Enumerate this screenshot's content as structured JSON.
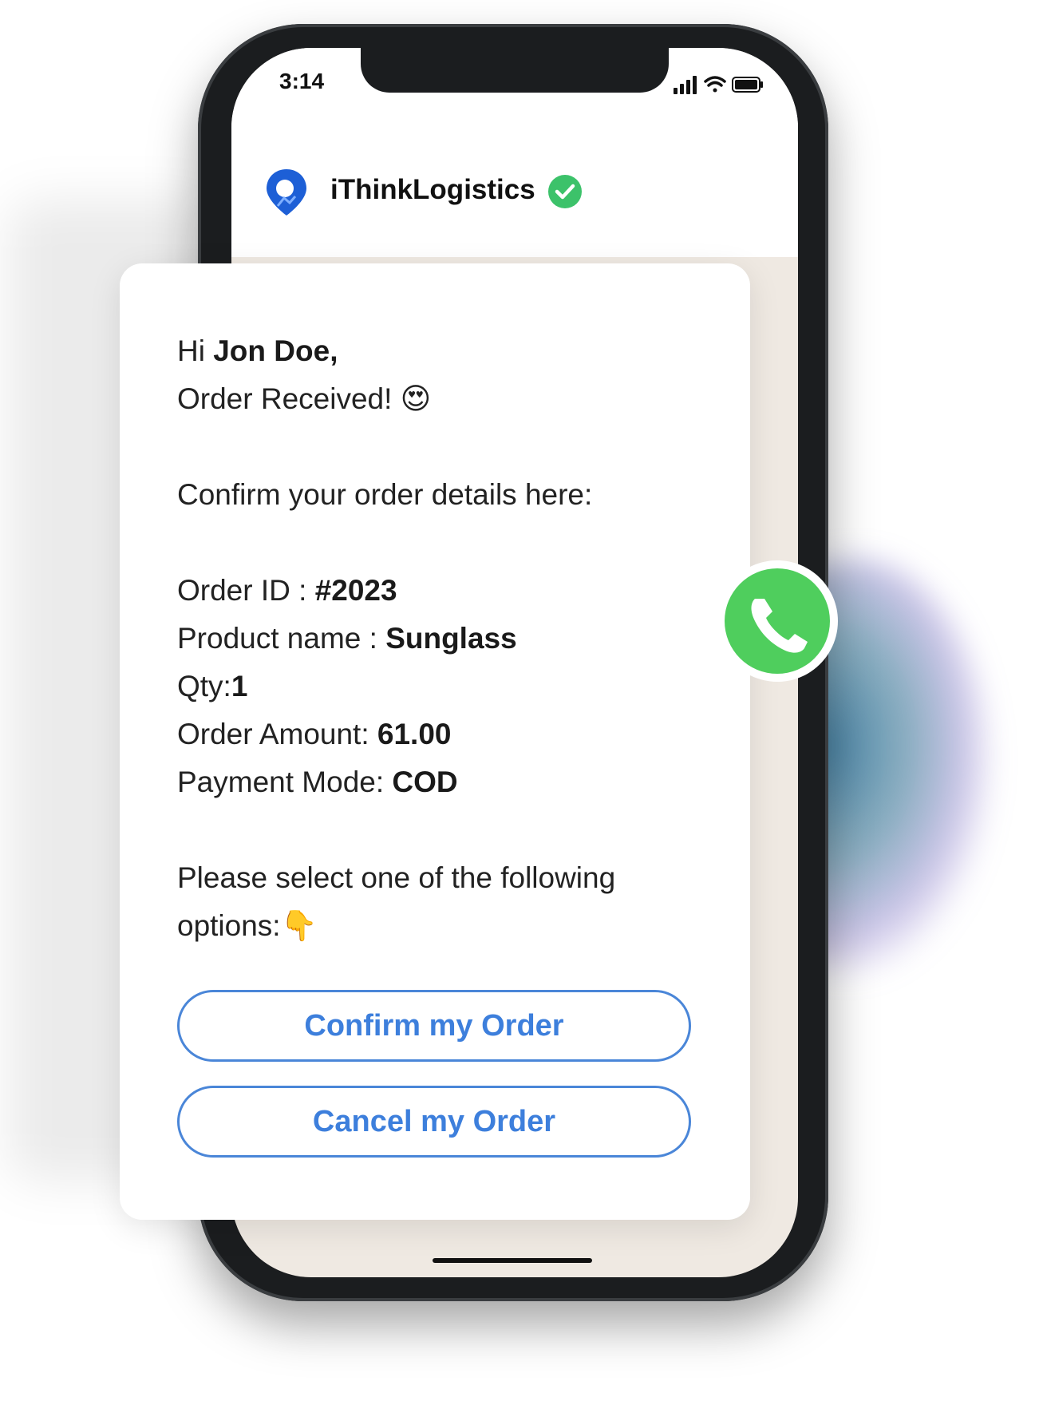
{
  "status": {
    "time": "3:14"
  },
  "chat": {
    "title": "iThinkLogistics"
  },
  "message": {
    "greeting_prefix": "Hi ",
    "name": "Jon Doe,",
    "line2": "Order Received!",
    "line2_emoji": "😍",
    "confirm_prompt": "Confirm your order details here:",
    "order_id_label": "Order ID : ",
    "order_id": "#2023",
    "product_label": "Product name : ",
    "product": "Sunglass",
    "qty_label": "Qty:",
    "qty": "1",
    "amount_label": "Order Amount: ",
    "amount": "61.00",
    "payment_label": "Payment Mode: ",
    "payment": "COD",
    "select_line1": "Please select one of the following",
    "select_line2": "options:",
    "select_emoji": "👇"
  },
  "buttons": {
    "confirm": "Confirm my Order",
    "cancel": "Cancel my Order"
  },
  "colors": {
    "accent": "#3d7fdc",
    "whatsapp": "#4fce5d",
    "verified": "#3cc26a",
    "chat_bg": "#efe9e2"
  },
  "icons": [
    "location-pin-logo-icon",
    "verified-check-icon",
    "signal-icon",
    "wifi-icon",
    "battery-icon",
    "whatsapp-icon"
  ]
}
